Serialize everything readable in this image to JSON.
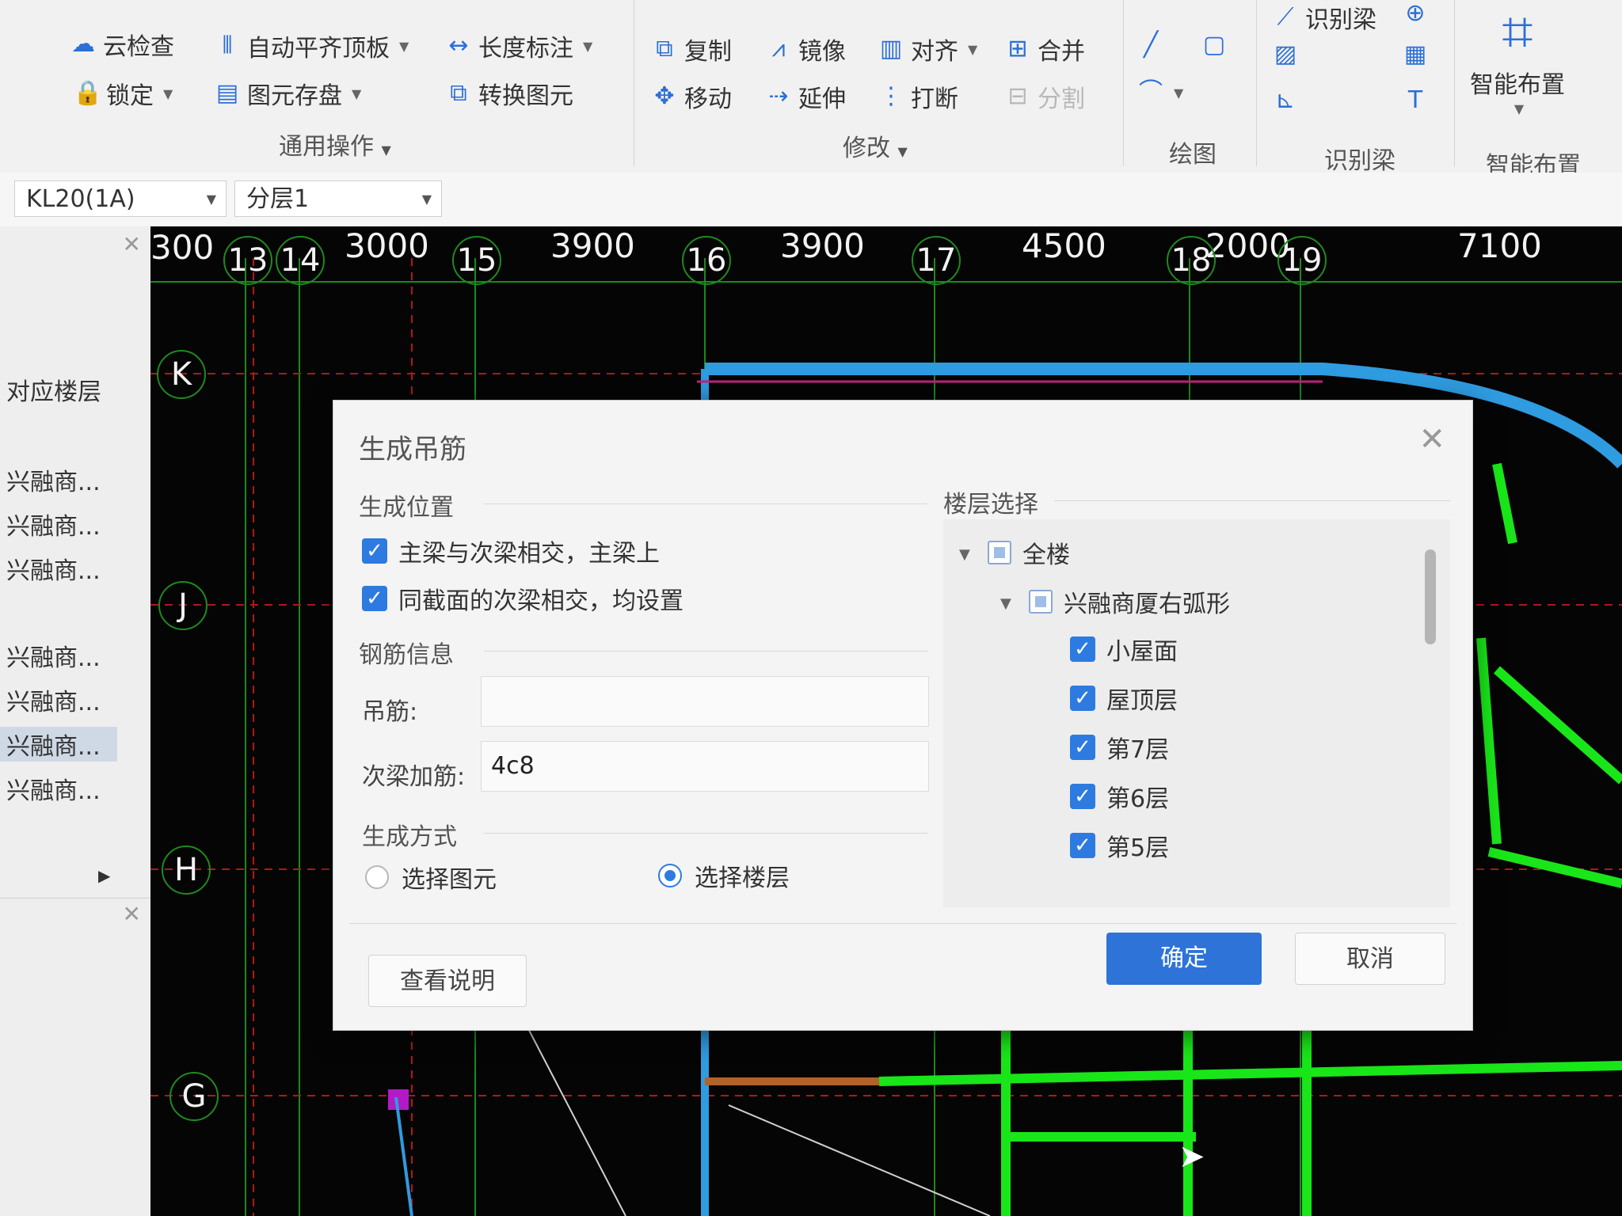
{
  "ribbon": {
    "general": {
      "cloud_check": "云检查",
      "lock": "锁定",
      "auto_align_slab": "自动平齐顶板",
      "element_save": "图元存盘",
      "length_dim": "长度标注",
      "convert_element": "转换图元",
      "group_label": "通用操作"
    },
    "modify": {
      "copy": "复制",
      "mirror": "镜像",
      "align": "对齐",
      "merge": "合并",
      "move": "移动",
      "extend": "延伸",
      "break": "打断",
      "split": "分割",
      "group_label": "修改"
    },
    "draw": {
      "group_label": "绘图"
    },
    "identify_beam": {
      "identify": "识别梁",
      "group_label": "识别梁"
    },
    "smart": {
      "smart_layout": "智能布置",
      "group_label": "智能布置"
    }
  },
  "selectors": {
    "element": "KL20(1A)",
    "layer": "分层1"
  },
  "left_panel": {
    "header": "对应楼层",
    "items": [
      "兴融商...",
      "兴融商...",
      "兴融商...",
      "兴融商...",
      "兴融商...",
      "兴融商...",
      "兴融商..."
    ]
  },
  "cad": {
    "spacings": [
      "300",
      "3000",
      "3900",
      "3900",
      "4500",
      "2000",
      "7100"
    ],
    "axes_x": [
      "13",
      "14",
      "15",
      "16",
      "17",
      "18",
      "19"
    ],
    "axes_y": [
      "K",
      "J",
      "H",
      "G"
    ]
  },
  "dialog": {
    "title": "生成吊筋",
    "gen_position": {
      "label": "生成位置",
      "opt1": "主梁与次梁相交，主梁上",
      "opt2": "同截面的次梁相交，均设置"
    },
    "rebar_info": {
      "label": "钢筋信息",
      "hanger_label": "吊筋:",
      "hanger_value": "",
      "secondary_label": "次梁加筋:",
      "secondary_value": "4c8"
    },
    "gen_method": {
      "label": "生成方式",
      "opt_select_element": "选择图元",
      "opt_select_floor": "选择楼层",
      "selected": "选择楼层"
    },
    "floor_select": {
      "label": "楼层选择",
      "all": "全楼",
      "building": "兴融商厦右弧形",
      "floors": [
        "小屋面",
        "屋顶层",
        "第7层",
        "第6层",
        "第5层"
      ]
    },
    "help_button": "查看说明",
    "ok_button": "确定",
    "cancel_button": "取消"
  },
  "colors": {
    "accent": "#2d73d8",
    "canvas_bg": "#050505",
    "beam_green": "#19e619",
    "slab_blue": "#2f9be0"
  }
}
